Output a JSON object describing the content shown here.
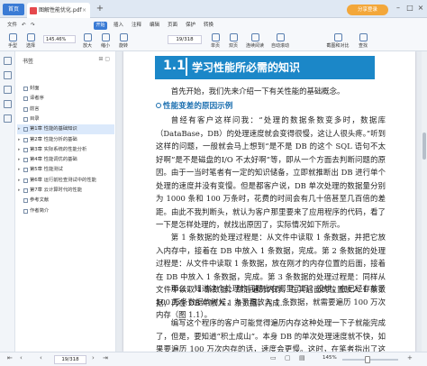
{
  "tabs": {
    "home": "首页",
    "document": "图解性能优化.pdf",
    "login": "分享登录"
  },
  "toolbar": {
    "menus": [
      "文件",
      "开始",
      "插入",
      "注释",
      "编辑",
      "页面",
      "保护",
      "转换"
    ],
    "open_label": "开始",
    "buttons": [
      "手型",
      "选择",
      "放大",
      "缩小",
      "旋转",
      "单页",
      "双页",
      "连续阅读",
      "自动滚动",
      "截图和对比",
      "查找"
    ],
    "zoom": "145.46%",
    "page": "19/318"
  },
  "bookmarks": {
    "title": "书签",
    "items": [
      {
        "label": "封面",
        "expandable": false
      },
      {
        "label": "译者序",
        "expandable": false
      },
      {
        "label": "前言",
        "expandable": false
      },
      {
        "label": "目录",
        "expandable": false
      },
      {
        "label": "第1章 性能的基础知识",
        "expandable": true,
        "selected": true
      },
      {
        "label": "第2章 性能分析的基础",
        "expandable": true
      },
      {
        "label": "第3章 实际系统的性能分析",
        "expandable": true
      },
      {
        "label": "第4章 性能调优的基础",
        "expandable": true
      },
      {
        "label": "第5章 性能测试",
        "expandable": true
      },
      {
        "label": "第6章 运行前检查测试中的性能",
        "expandable": true
      },
      {
        "label": "第7章 云计算时代的性能",
        "expandable": true
      },
      {
        "label": "参考文献",
        "expandable": false
      },
      {
        "label": "作者简介",
        "expandable": false
      }
    ]
  },
  "document": {
    "chapter_num": "1.1",
    "chapter_title": "学习性能所必需的知识",
    "intro": "首先开始，我们先来介绍一下有关性能的基础概念。",
    "section": "性能变差的原因示例",
    "para1": "曾经有客户这样问我：“处理的数据条数变多时，数据库（DataBase，DB）的处理速度就会变得很慢，这让人很头疼。”听到这样的问题，一般就会马上想到“是不是 DB 的这个 SQL 语句不太好啊”是不是磁盘的I/O 不太好啊”等，即从一个方面去判断问题的原因。由于一当时笔者有一定的知识储备，立即就推断出 DB 进行单个处理的速度并没有变慢。但是都客户说，DB 单次处理的数据量分别为 1000 条和 100 万条时，花费的时间会有几十倍甚至几百倍的差距。由此不我判断头，就认为客户那里要来了应用程序的代码，看了一下是怎样处理的，就找出原因了，实际情况如下所示。",
    "para2": "第 1 条数据的处理过程是：从文件中读取 1 条数据，并把它放入内存中，接着在 DB 中放入 1 条数据，完成。第 2 条数据的处理过程是：从文件中读取 1 条数据，放在刚才的内存位置的后面，接着在 DB 中放入 1 条数据，完成。第 3 条数据的处理过程是：同样从文件中读取 1 条数据，然后遍历内存，在其后面的位置放入 1 条数据，再在 DB 中放入 1 条数据，完成……",
    "para3": "那么，知道这个处理的问题出在哪里了吗？没错，在已经存放了 100 万条数据的时候，为了再放入 1 条数据，就需要遍历 100 万次内存（图 1.1）。",
    "para4": "编写这个程序的客户可能觉得遍历内存这种处理一下子就能完成了，但是，要知道“积土成山”。本身 DB 的单次处理速度就不快，如果要遍历 100 万次内存的话，速度会更慢。这时，在笔者指出了这一点后，客"
  },
  "status": {
    "page": "19/318",
    "zoom": "145%"
  }
}
